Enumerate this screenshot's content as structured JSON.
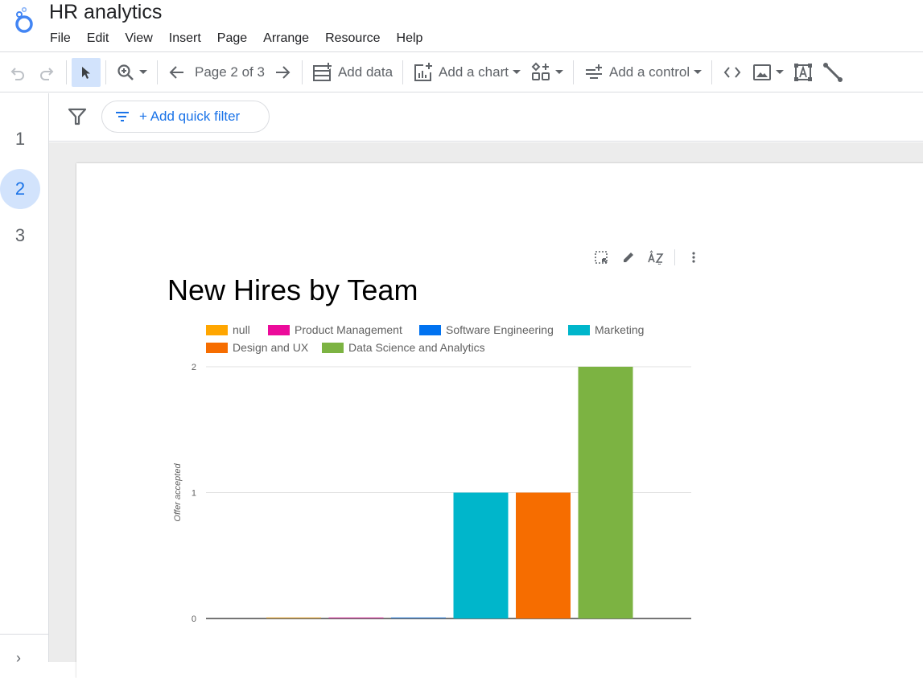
{
  "app": {
    "title": "HR analytics",
    "menu": [
      "File",
      "Edit",
      "View",
      "Insert",
      "Page",
      "Arrange",
      "Resource",
      "Help"
    ]
  },
  "toolbar": {
    "page_indicator": "Page 2 of 3",
    "add_data": "Add data",
    "add_chart": "Add a chart",
    "add_control": "Add a control"
  },
  "sidebar": {
    "pages": [
      "1",
      "2",
      "3"
    ],
    "current_page": "2",
    "expand_icon": "›"
  },
  "filterbar": {
    "quick_filter_label": "+ Add quick filter"
  },
  "chart_data": {
    "type": "bar",
    "title": "New Hires by Team",
    "xlabel": "",
    "ylabel": "Offer accepted",
    "ylim": [
      0,
      2
    ],
    "yticks": [
      "0",
      "1",
      "2"
    ],
    "grid": true,
    "legend_position": "top",
    "categories": [
      "null",
      "Product Management",
      "Software Engineering",
      "Marketing",
      "Design and UX",
      "Data Science and Analytics"
    ],
    "values": [
      0,
      0,
      0,
      1,
      1,
      2
    ],
    "colors": [
      "#ffa600",
      "#ec0b9b",
      "#0072f0",
      "#00b6cb",
      "#f66d00",
      "#7cb342"
    ]
  }
}
